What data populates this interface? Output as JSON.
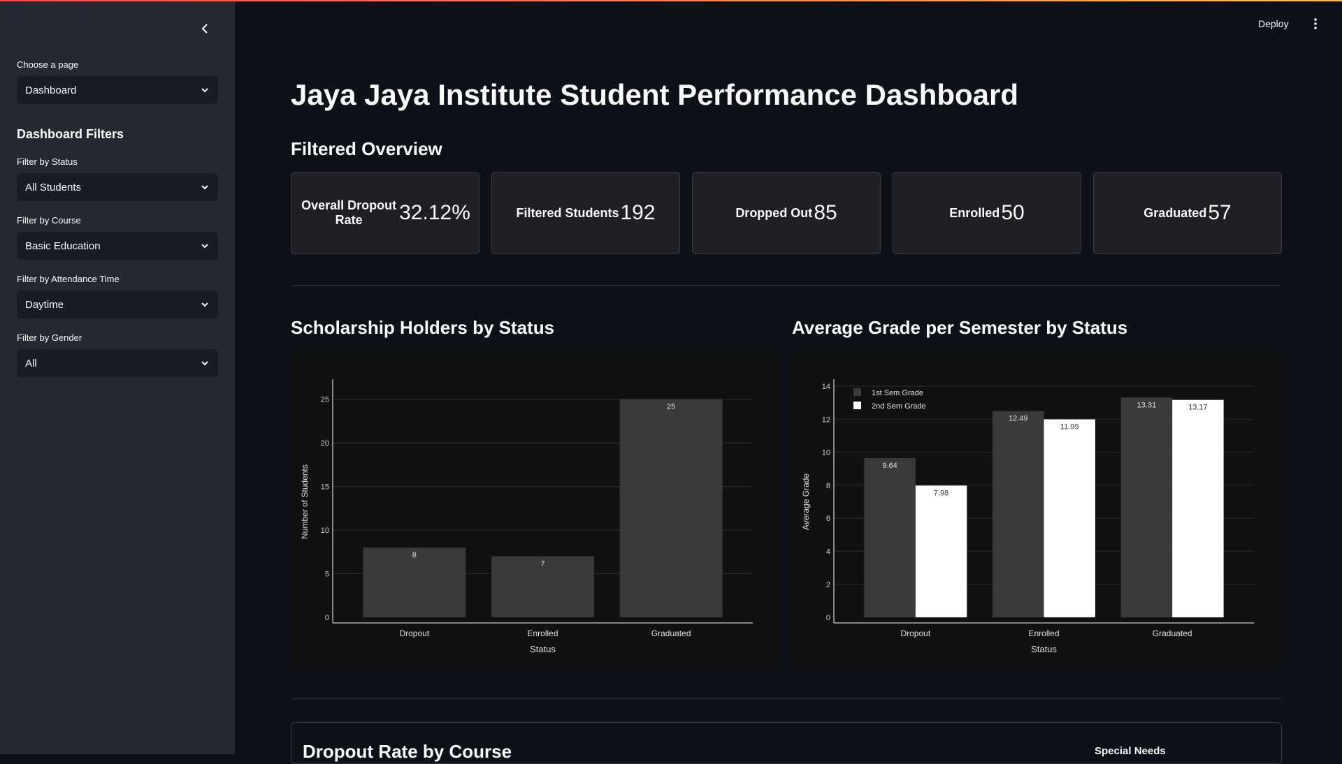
{
  "sidebar": {
    "choose_page_label": "Choose a page",
    "choose_page_value": "Dashboard",
    "filters_heading": "Dashboard Filters",
    "filters": [
      {
        "label": "Filter by Status",
        "value": "All Students"
      },
      {
        "label": "Filter by Course",
        "value": "Basic Education"
      },
      {
        "label": "Filter by Attendance Time",
        "value": "Daytime"
      },
      {
        "label": "Filter by Gender",
        "value": "All"
      }
    ]
  },
  "header": {
    "deploy_label": "Deploy"
  },
  "main": {
    "title": "Jaya Jaya Institute Student Performance Dashboard",
    "overview_heading": "Filtered Overview",
    "metrics": [
      {
        "label": "Overall Dropout Rate",
        "value": "32.12%"
      },
      {
        "label": "Filtered Students",
        "value": "192"
      },
      {
        "label": "Dropped Out",
        "value": "85"
      },
      {
        "label": "Enrolled",
        "value": "50"
      },
      {
        "label": "Graduated",
        "value": "57"
      }
    ],
    "chart1_heading": "Scholarship Holders by Status",
    "chart2_heading": "Average Grade per Semester by Status",
    "bottom_card": {
      "title": "Dropout Rate by Course",
      "side_label": "Special Needs"
    }
  },
  "colors": {
    "bar_dark": "#3a3a3a",
    "bar_light": "#ffffff",
    "accent_gradient_start": "#ff4b4b",
    "accent_gradient_end": "#ffbd45"
  },
  "chart_data": [
    {
      "type": "bar",
      "categories": [
        "Dropout",
        "Enrolled",
        "Graduated"
      ],
      "values": [
        8,
        7,
        25
      ],
      "xlabel": "Status",
      "ylabel": "Number of Students",
      "ylim": [
        0,
        26.5
      ],
      "yticks": [
        0,
        5,
        10,
        15,
        20,
        25
      ],
      "grid": true
    },
    {
      "type": "bar",
      "categories": [
        "Dropout",
        "Enrolled",
        "Graduated"
      ],
      "series": [
        {
          "name": "1st Sem Grade",
          "values": [
            9.64,
            12.49,
            13.31
          ]
        },
        {
          "name": "2nd Sem Grade",
          "values": [
            7.98,
            11.99,
            13.17
          ]
        }
      ],
      "xlabel": "Status",
      "ylabel": "Average Grade",
      "ylim": [
        0,
        14
      ],
      "yticks": [
        0,
        2,
        4,
        6,
        8,
        10,
        12,
        14
      ],
      "legend": "top-left",
      "grid": true
    }
  ]
}
